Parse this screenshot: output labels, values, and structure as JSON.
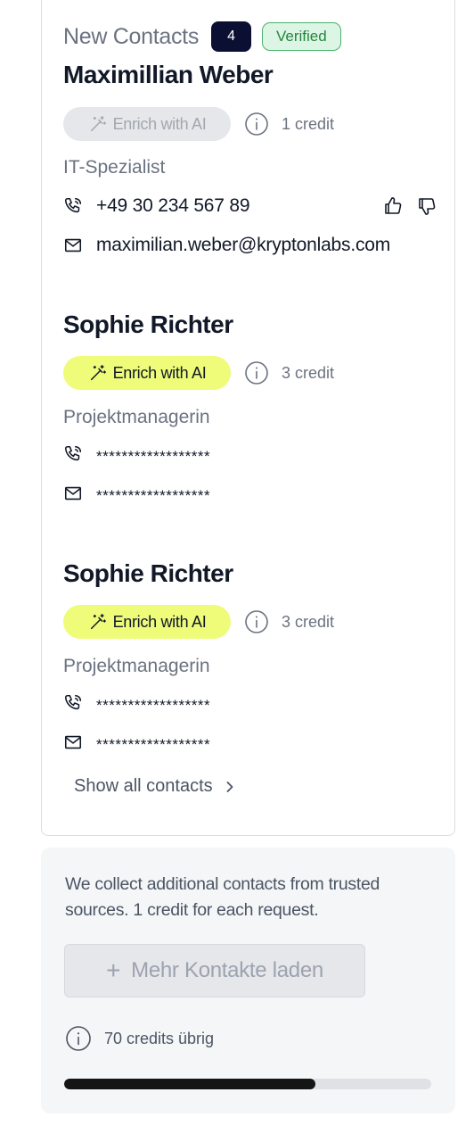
{
  "header": {
    "title": "New Contacts",
    "count": "4",
    "verified_label": "Verified"
  },
  "contacts": [
    {
      "name": "Maximillian Weber",
      "enrich_label": "Enrich with AI",
      "enrich_state": "disabled",
      "credit": "1 credit",
      "role": "IT-Spezialist",
      "phone": "+49 30 234 567 89",
      "email": "maximilian.weber@kryptonlabs.com"
    },
    {
      "name": "Sophie Richter",
      "enrich_label": "Enrich with AI",
      "enrich_state": "active",
      "credit": "3 credit",
      "role": "Projektmanagerin",
      "phone": "******************",
      "email": "******************"
    },
    {
      "name": "Sophie Richter",
      "enrich_label": "Enrich with AI",
      "enrich_state": "active",
      "credit": "3 credit",
      "role": "Projektmanagerin",
      "phone": "******************",
      "email": "******************"
    }
  ],
  "show_all_label": "Show all contacts",
  "panel": {
    "description": "We collect additional contacts from trusted sources.  1 credit for each request.",
    "load_label": "Mehr Kontakte laden",
    "credits_label": "70 credits übrig",
    "credits_progress": 0.685
  },
  "colors": {
    "badge_dark": "#0b1033",
    "verified_green": "#25853f",
    "enrich_yellow": "#eefc7a",
    "progress_fill": "#151515"
  }
}
